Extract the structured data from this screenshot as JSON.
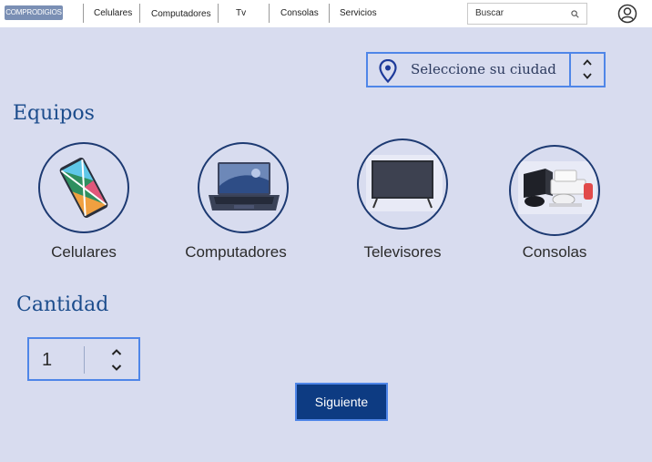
{
  "header": {
    "logo_text": "COMPRODIGIOS",
    "nav": [
      "Celulares",
      "Computadores",
      "Tv",
      "Consolas",
      "Servicios"
    ],
    "search_placeholder": "Buscar"
  },
  "city_select": {
    "label": "Seleccione su ciudad"
  },
  "equipment": {
    "title": "Equipos",
    "items": [
      {
        "label": "Celulares",
        "icon": "smartphone-image"
      },
      {
        "label": "Computadores",
        "icon": "laptop-image"
      },
      {
        "label": "Televisores",
        "icon": "television-image"
      },
      {
        "label": "Consolas",
        "icon": "game-console-image"
      }
    ]
  },
  "quantity": {
    "title": "Cantidad",
    "value": "1"
  },
  "next_button": {
    "label": "Siguiente"
  },
  "colors": {
    "background": "#d8dcef",
    "title": "#1b4c8c",
    "accent_border": "#4f86e8",
    "button": "#0d3b82",
    "circle_border": "#1d3a72"
  }
}
